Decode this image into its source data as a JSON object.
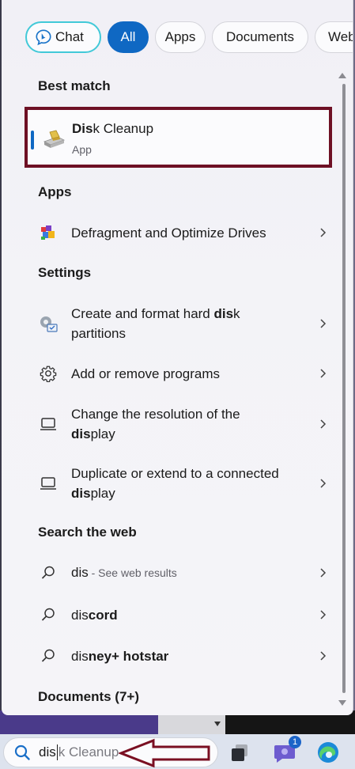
{
  "filters": {
    "chat": "Chat",
    "all": "All",
    "apps": "Apps",
    "documents": "Documents",
    "web": "Web"
  },
  "best_match": {
    "title": "Best match",
    "app_name_bold": "Dis",
    "app_name_rest": "k Cleanup",
    "app_type": "App"
  },
  "apps_section": {
    "title": "Apps",
    "items": [
      {
        "label": "Defragment and Optimize Drives",
        "icon": "defragment-icon"
      }
    ]
  },
  "settings_section": {
    "title": "Settings",
    "items": [
      {
        "line1_pre": "Create and format hard ",
        "line1_bold": "dis",
        "line1_post": "k",
        "line2": "partitions",
        "icon": "disk-management-icon"
      },
      {
        "label": "Add or remove programs",
        "icon": "gear-icon"
      },
      {
        "line1": "Change the resolution of the",
        "line2_bold": "dis",
        "line2_post": "play",
        "icon": "laptop-icon"
      },
      {
        "line1": "Duplicate or extend to a connected",
        "line2_bold": "dis",
        "line2_post": "play",
        "icon": "laptop-icon"
      }
    ]
  },
  "web_section": {
    "title": "Search the web",
    "items": [
      {
        "bold": "dis",
        "rest": "",
        "hint": " - See web results",
        "icon": "search-icon"
      },
      {
        "bold": "dis",
        "rest": "cord",
        "icon": "search-icon"
      },
      {
        "bold": "dis",
        "rest": "ney+ hotstar",
        "icon": "search-icon"
      }
    ]
  },
  "documents_section": {
    "title": "Documents (7+)"
  },
  "taskbar": {
    "search_typed": "dis",
    "search_suggestion": "k Cleanup",
    "teams_badge": "1"
  },
  "colors": {
    "accent": "#0f68c3",
    "chat_border": "#42c9d8",
    "highlight_box": "#6e1024",
    "annotation_arrow": "#7a0f22"
  }
}
